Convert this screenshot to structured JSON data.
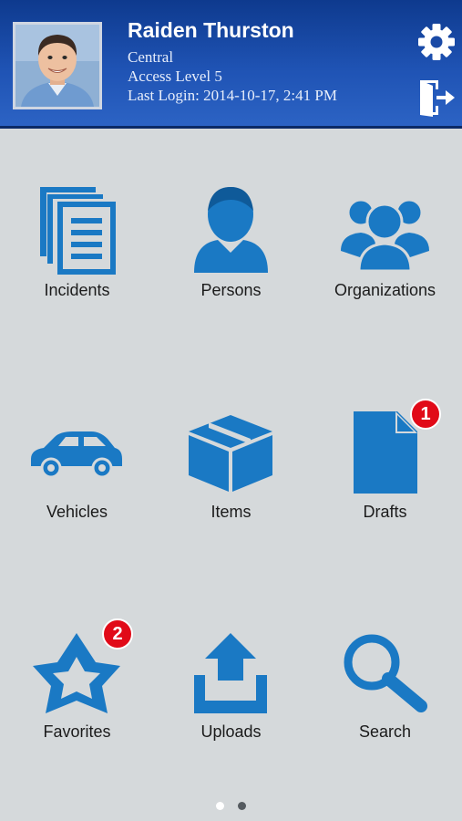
{
  "user": {
    "name": "Raiden Thurston",
    "agency": "Central",
    "access_level": "Access Level 5",
    "last_login": "Last Login: 2014-10-17, 2:41 PM"
  },
  "header": {
    "settings_icon": "gear-icon",
    "logout_icon": "logout-door-icon"
  },
  "colors": {
    "header_blue": "#1f53b4",
    "icon_blue": "#1a79c4",
    "badge_red": "#e10a18",
    "background": "#d5d9db"
  },
  "tiles": [
    {
      "label": "Incidents",
      "icon": "documents-icon"
    },
    {
      "label": "Persons",
      "icon": "person-icon"
    },
    {
      "label": "Organizations",
      "icon": "group-icon"
    },
    {
      "label": "Vehicles",
      "icon": "car-icon"
    },
    {
      "label": "Items",
      "icon": "box-icon"
    },
    {
      "label": "Drafts",
      "icon": "draft-document-icon",
      "badge": "1"
    },
    {
      "label": "Favorites",
      "icon": "star-icon",
      "badge": "2"
    },
    {
      "label": "Uploads",
      "icon": "upload-icon"
    },
    {
      "label": "Search",
      "icon": "search-icon"
    }
  ],
  "pager": {
    "pages": 2,
    "current": 1
  }
}
